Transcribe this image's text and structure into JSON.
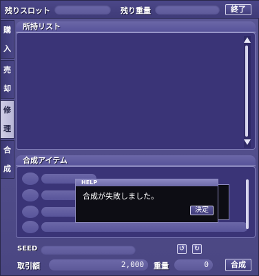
{
  "top": {
    "remaining_slots_label": "残りスロット",
    "remaining_weight_label": "残り重量",
    "close_label": "終了"
  },
  "tabs": [
    {
      "chars": [
        "購",
        "入"
      ],
      "active": false
    },
    {
      "chars": [
        "売",
        "却"
      ],
      "active": false
    },
    {
      "chars": [
        "修",
        "理"
      ],
      "active": true
    },
    {
      "chars": [
        "合",
        "成"
      ],
      "active": false
    }
  ],
  "owned_list": {
    "title": "所持リスト"
  },
  "synth_items": {
    "title": "合成アイテム"
  },
  "help": {
    "title": "HELP",
    "message": "合成が失敗しました。",
    "ok_label": "決定"
  },
  "seed": {
    "label": "SEED"
  },
  "footer": {
    "price_label": "取引額",
    "price_value": "2,000",
    "weight_label": "重量",
    "weight_value": "0",
    "synthesize_label": "合成"
  }
}
